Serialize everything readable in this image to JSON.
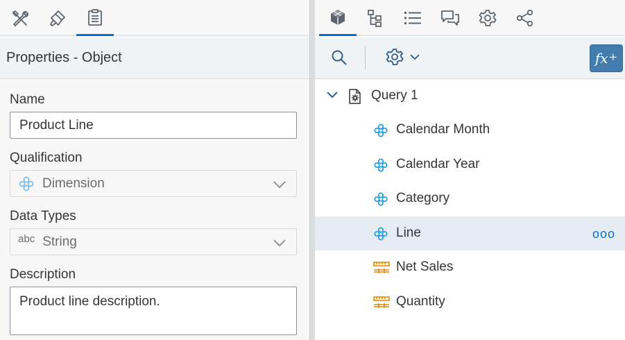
{
  "left_toolbar": {
    "icons": [
      "tools-icon",
      "paint-brush-icon",
      "clipboard-icon"
    ],
    "active_index": 2
  },
  "properties": {
    "title": "Properties - Object",
    "name_label": "Name",
    "name_value": "Product Line",
    "qualification_label": "Qualification",
    "qualification_value": "Dimension",
    "data_types_label": "Data Types",
    "data_types_prefix": "abc",
    "data_types_value": "String",
    "description_label": "Description",
    "description_value": "Product line description."
  },
  "right_toolbar": {
    "icons": [
      "cube-icon",
      "hierarchy-icon",
      "list-icon",
      "comments-icon",
      "gear-icon",
      "share-icon"
    ],
    "active_index": 0
  },
  "right_subbar": {
    "fx_label": "fx",
    "fx_sup": "+"
  },
  "tree": {
    "root_label": "Query 1",
    "items": [
      {
        "label": "Calendar Month",
        "type": "dimension",
        "selected": false
      },
      {
        "label": "Calendar Year",
        "type": "dimension",
        "selected": false
      },
      {
        "label": "Category",
        "type": "dimension",
        "selected": false
      },
      {
        "label": "Line",
        "type": "dimension",
        "selected": true,
        "more": "ooo"
      },
      {
        "label": "Net Sales",
        "type": "measure",
        "selected": false
      },
      {
        "label": "Quantity",
        "type": "measure",
        "selected": false
      }
    ]
  },
  "colors": {
    "accent": "#0a6ed1",
    "dimension_icon": "#1f9be0",
    "measure_icon": "#e08a00",
    "selected_row": "#e5ecf3"
  }
}
